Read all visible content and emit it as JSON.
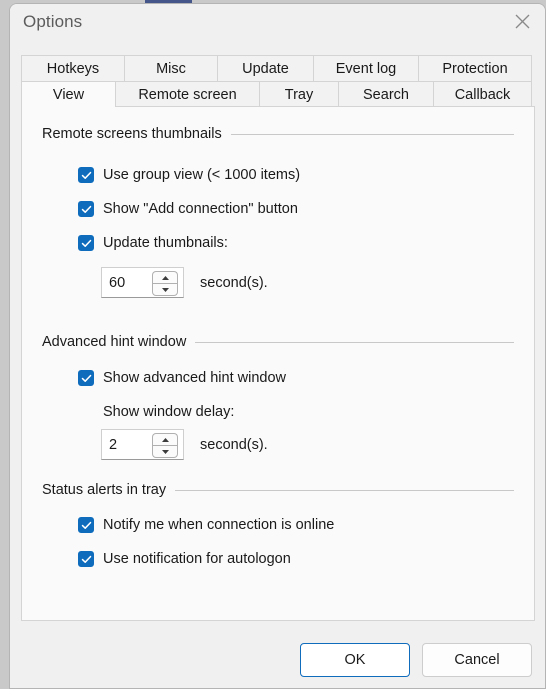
{
  "window": {
    "title": "Options",
    "close_icon": "close-icon"
  },
  "tabs": {
    "row_top": [
      {
        "label": "Hotkeys",
        "width": 104,
        "selected": false
      },
      {
        "label": "Misc",
        "width": 94,
        "selected": false
      },
      {
        "label": "Update",
        "width": 97,
        "selected": false
      },
      {
        "label": "Event log",
        "width": 106,
        "selected": false
      },
      {
        "label": "Protection",
        "width": 114,
        "selected": false
      }
    ],
    "row_bottom": [
      {
        "label": "View",
        "width": 95,
        "selected": true
      },
      {
        "label": "Remote screen",
        "width": 145,
        "selected": false
      },
      {
        "label": "Tray",
        "width": 80,
        "selected": false
      },
      {
        "label": "Search",
        "width": 96,
        "selected": false
      },
      {
        "label": "Callback",
        "width": 99,
        "selected": false
      }
    ]
  },
  "groups": {
    "thumbnails": {
      "title": "Remote screens thumbnails",
      "checks": [
        {
          "label": "Use group view (< 1000 items)",
          "checked": true
        },
        {
          "label": "Show \"Add connection\" button",
          "checked": true
        },
        {
          "label": "Update thumbnails:",
          "checked": true
        }
      ],
      "spinner": {
        "value": "60",
        "suffix": "second(s).",
        "up_icon": "caret-up-icon",
        "down_icon": "caret-down-icon"
      }
    },
    "hint": {
      "title": "Advanced hint window",
      "checks": [
        {
          "label": "Show advanced hint window",
          "checked": true
        }
      ],
      "delay_label": "Show window delay:",
      "spinner": {
        "value": "2",
        "suffix": "second(s).",
        "up_icon": "caret-up-icon",
        "down_icon": "caret-down-icon"
      }
    },
    "tray": {
      "title": "Status alerts in tray",
      "checks": [
        {
          "label": "Notify me when connection is online",
          "checked": true
        },
        {
          "label": "Use notification for autologon",
          "checked": true
        }
      ]
    }
  },
  "footer": {
    "ok_label": "OK",
    "cancel_label": "Cancel"
  },
  "colors": {
    "accent": "#0f6cbd",
    "window_bg": "#f0f0f0",
    "page_bg": "#fafafa",
    "text": "#1a1a1a",
    "title_text": "#5c5c5c",
    "border": "#d4d4d4",
    "rule": "#c8c8c8",
    "backdrop_window": "#44568a"
  }
}
